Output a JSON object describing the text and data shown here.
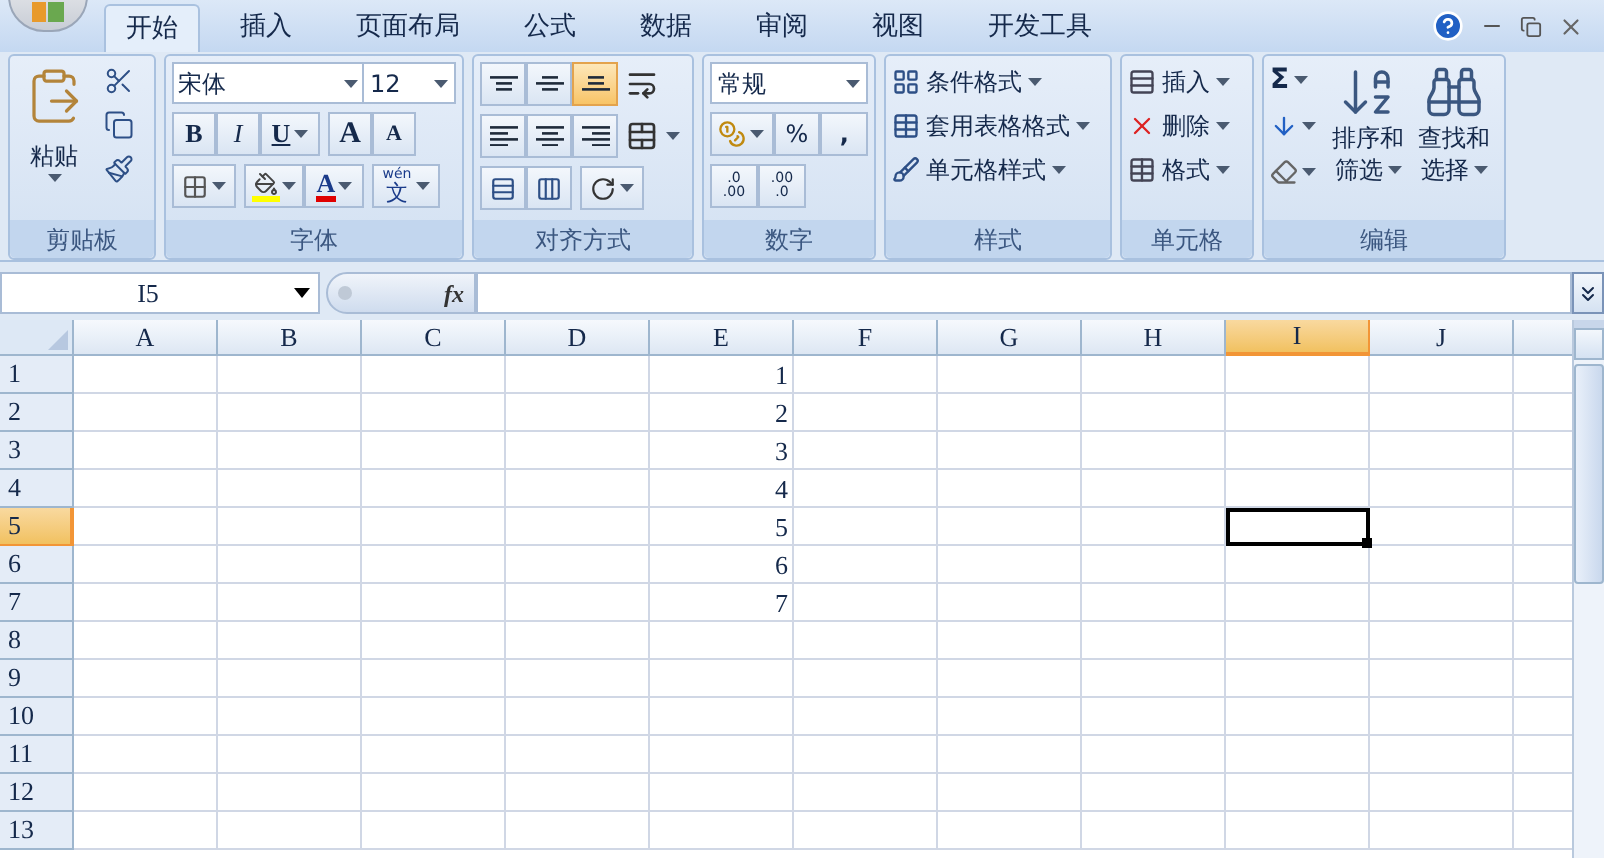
{
  "tabs": [
    {
      "label": "开始",
      "selected": true
    },
    {
      "label": "插入",
      "selected": false
    },
    {
      "label": "页面布局",
      "selected": false
    },
    {
      "label": "公式",
      "selected": false
    },
    {
      "label": "数据",
      "selected": false
    },
    {
      "label": "审阅",
      "selected": false
    },
    {
      "label": "视图",
      "selected": false
    },
    {
      "label": "开发工具",
      "selected": false
    }
  ],
  "clipboard": {
    "label": "剪贴板",
    "paste": "粘贴"
  },
  "font": {
    "label": "字体",
    "name": "宋体",
    "size": "12",
    "bold": "B",
    "italic": "I",
    "underline": "U",
    "grow": "A",
    "shrink": "A",
    "font_color": "A",
    "phonetic_top": "wén",
    "phonetic_bottom": "文"
  },
  "alignment": {
    "label": "对齐方式",
    "vertical": [
      {
        "kind": "top",
        "selected": false
      },
      {
        "kind": "middle",
        "selected": false
      },
      {
        "kind": "bottom",
        "selected": true
      }
    ],
    "horizontal": [
      {
        "kind": "left",
        "selected": false
      },
      {
        "kind": "center",
        "selected": false
      },
      {
        "kind": "right",
        "selected": false
      }
    ]
  },
  "number": {
    "label": "数字",
    "format": "常规",
    "percent": "%",
    "comma": ",",
    "increase_top": ".0",
    "increase_bottom": ".00",
    "decrease_top": ".00",
    "decrease_bottom": ".0"
  },
  "styles": {
    "label": "样式",
    "items": [
      "条件格式",
      "套用表格格式",
      "单元格样式"
    ]
  },
  "cells": {
    "label": "单元格",
    "items": [
      "插入",
      "删除",
      "格式"
    ]
  },
  "editing": {
    "label": "编辑",
    "sum": "Σ",
    "sort_top": "排序和",
    "sort_bottom": "筛选",
    "find_top": "查找和",
    "find_bottom": "选择"
  },
  "formula_bar": {
    "name_box": "I5",
    "fx": "fx"
  },
  "sheet": {
    "columns": [
      {
        "label": "A",
        "selected": false
      },
      {
        "label": "B",
        "selected": false
      },
      {
        "label": "C",
        "selected": false
      },
      {
        "label": "D",
        "selected": false
      },
      {
        "label": "E",
        "selected": false
      },
      {
        "label": "F",
        "selected": false
      },
      {
        "label": "G",
        "selected": false
      },
      {
        "label": "H",
        "selected": false
      },
      {
        "label": "I",
        "selected": true
      },
      {
        "label": "J",
        "selected": false
      }
    ],
    "rows": [
      {
        "label": "1",
        "selected": false,
        "cells": {
          "4": "1"
        }
      },
      {
        "label": "2",
        "selected": false,
        "cells": {
          "4": "2"
        }
      },
      {
        "label": "3",
        "selected": false,
        "cells": {
          "4": "3"
        }
      },
      {
        "label": "4",
        "selected": false,
        "cells": {
          "4": "4"
        }
      },
      {
        "label": "5",
        "selected": true,
        "cells": {
          "4": "5"
        }
      },
      {
        "label": "6",
        "selected": false,
        "cells": {
          "4": "6"
        }
      },
      {
        "label": "7",
        "selected": false,
        "cells": {
          "4": "7"
        }
      },
      {
        "label": "8",
        "selected": false,
        "cells": {}
      },
      {
        "label": "9",
        "selected": false,
        "cells": {}
      },
      {
        "label": "10",
        "selected": false,
        "cells": {}
      },
      {
        "label": "11",
        "selected": false,
        "cells": {}
      },
      {
        "label": "12",
        "selected": false,
        "cells": {}
      },
      {
        "label": "13",
        "selected": false,
        "cells": {}
      }
    ]
  }
}
